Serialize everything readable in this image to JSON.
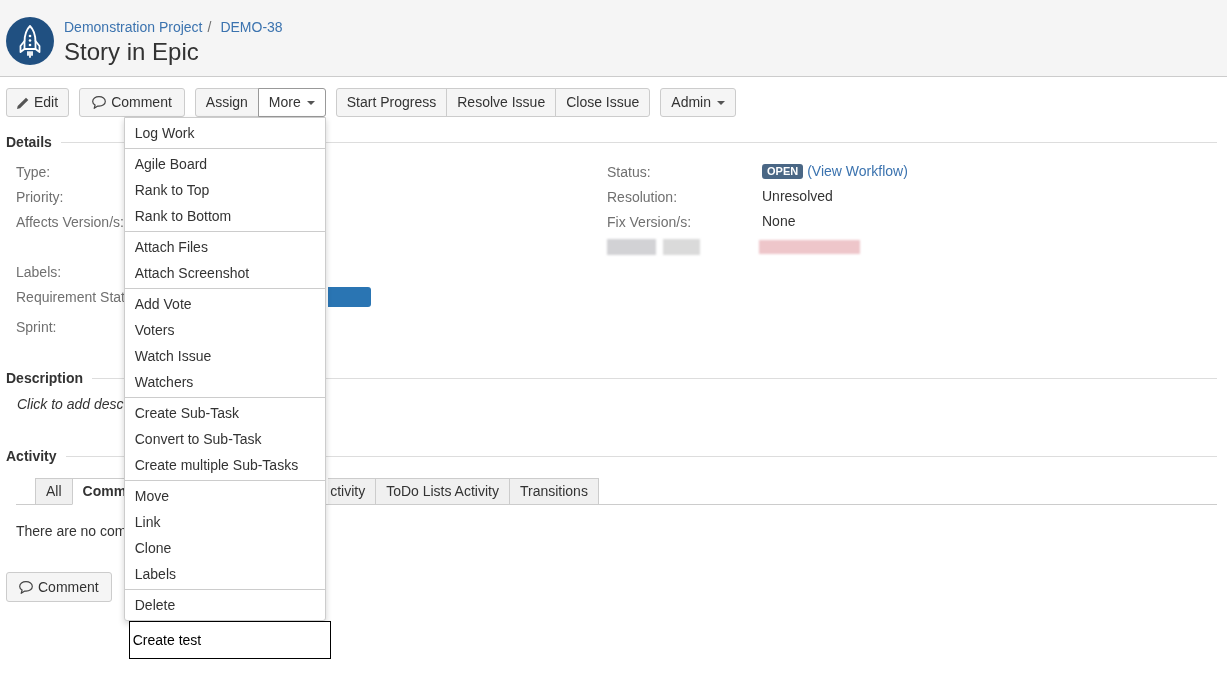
{
  "header": {
    "breadcrumbs": [
      "Demonstration Project",
      "DEMO-38"
    ],
    "separator": "/",
    "title": "Story in Epic"
  },
  "toolbar": [
    [
      {
        "label": "Edit",
        "kind": "edit"
      }
    ],
    [
      {
        "label": "Comment",
        "kind": "comment"
      }
    ],
    [
      {
        "label": "Assign",
        "kind": "plain"
      },
      {
        "label": "More",
        "kind": "menu",
        "expanded": true,
        "menu": [
          [
            "Log Work"
          ],
          [
            "Agile Board",
            "Rank to Top",
            "Rank to Bottom"
          ],
          [
            "Attach Files",
            "Attach Screenshot"
          ],
          [
            "Add Vote",
            "Voters",
            "Watch Issue",
            "Watchers"
          ],
          [
            "Create Sub-Task",
            "Convert to Sub-Task",
            "Create multiple Sub-Tasks"
          ],
          [
            "Move",
            "Link",
            "Clone",
            "Labels"
          ],
          [
            "Delete"
          ]
        ]
      }
    ],
    [
      {
        "label": "Start Progress",
        "kind": "plain"
      },
      {
        "label": "Resolve Issue",
        "kind": "plain"
      },
      {
        "label": "Close Issue",
        "kind": "plain"
      }
    ],
    [
      {
        "label": "Admin",
        "kind": "menu",
        "expanded": false
      }
    ]
  ],
  "tooltip": "Create test",
  "details": {
    "heading": "Details",
    "left": [
      {
        "label": "Type:",
        "kind": "plain"
      },
      {
        "label": "Priority:",
        "kind": "plain"
      },
      {
        "label": "Affects Version/s:",
        "kind": "plain"
      },
      {
        "label": "Labels:",
        "kind": "plain"
      },
      {
        "label": "Requirement Stat",
        "kind": "lozenge"
      },
      {
        "label": "Sprint:",
        "kind": "plain"
      }
    ],
    "right": [
      {
        "label": "Status:",
        "kind": "status",
        "status": "OPEN",
        "link": "(View Workflow)"
      },
      {
        "label": "Resolution:",
        "kind": "text",
        "value": "Unresolved"
      },
      {
        "label": "Fix Version/s:",
        "kind": "text",
        "value": "None"
      },
      {
        "kind": "redacted"
      }
    ]
  },
  "description": {
    "heading": "Description",
    "prompt": "Click to add desc"
  },
  "activity": {
    "heading": "Activity",
    "tabs": [
      {
        "label": "All",
        "selected": false
      },
      {
        "label": "Comm",
        "selected": true
      },
      {
        "label": "ctivity",
        "selected": false
      },
      {
        "label": "ToDo Lists Activity",
        "selected": false
      },
      {
        "label": "Transitions",
        "selected": false
      }
    ],
    "empty_message": "There are no com",
    "comment_button": "Comment"
  }
}
